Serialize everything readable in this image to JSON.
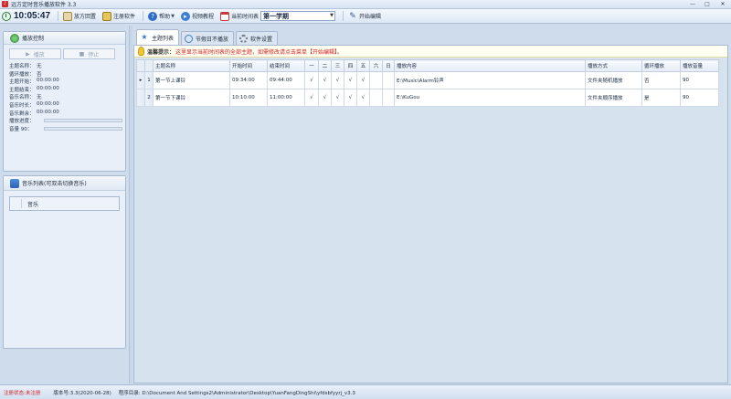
{
  "window": {
    "title": "远方定时音乐播放软件 3.3",
    "min": "—",
    "max": "□",
    "close": "✕"
  },
  "toolbar": {
    "time": "10:05:47",
    "desktop": "放方回置",
    "register": "注册软件",
    "help": "帮助",
    "video_tutorial": "视频教程",
    "current_schedule_label": "当前时间表",
    "current_schedule_value": "第一学期",
    "edit": "开始编辑"
  },
  "play_control": {
    "title": "播放控制",
    "play_label": "播放",
    "stop_label": "停止",
    "info": [
      {
        "label": "主题名称：",
        "value": "无"
      },
      {
        "label": "循环播放：",
        "value": "否"
      },
      {
        "label": "主题开始：",
        "value": "00:00:00"
      },
      {
        "label": "主题结束：",
        "value": "00:00:00"
      },
      {
        "label": "音乐名称：",
        "value": "无"
      },
      {
        "label": "音乐时长：",
        "value": "00:00:00"
      },
      {
        "label": "音乐剩余：",
        "value": "00:00:00"
      }
    ],
    "progress_label": "播放进度：",
    "volume_label": "音量 90：",
    "progress": 0,
    "volume": 90
  },
  "music_list": {
    "title": "音乐列表(可双击切换音乐)",
    "column_header": "音乐"
  },
  "tabs": [
    {
      "label": "主题列表",
      "icon": "star-icon"
    },
    {
      "label": "节假日不播放",
      "icon": "search-icon"
    },
    {
      "label": "软件设置",
      "icon": "gear-icon"
    }
  ],
  "notice": {
    "label": "温馨提示：",
    "text": "这里显示当前时间表的全部主题，如需修改请点击菜单【开始编辑】。"
  },
  "table": {
    "headers": [
      "主题名称",
      "开始时间",
      "结束时间",
      "一",
      "二",
      "三",
      "四",
      "五",
      "六",
      "日",
      "播放内容",
      "播放方式",
      "循环播放",
      "播放音量"
    ],
    "rows": [
      {
        "num": "1",
        "current": "▸",
        "name": "第一节上课铃",
        "start": "09:34:00",
        "end": "09:44:00",
        "days": [
          "√",
          "√",
          "√",
          "√",
          "√",
          "",
          ""
        ],
        "content": "E:\\Music\\Alarm铃声",
        "mode": "文件夹随机播放",
        "loop": "否",
        "volume": "90"
      },
      {
        "num": "2",
        "current": "",
        "name": "第一节下课铃",
        "start": "10:10:00",
        "end": "11:00:00",
        "days": [
          "√",
          "√",
          "√",
          "√",
          "√",
          "",
          ""
        ],
        "content": "E:\\KuGou",
        "mode": "文件夹顺序播放",
        "loop": "是",
        "volume": "90"
      }
    ]
  },
  "status": {
    "reg_status": "注册状态:未注册",
    "version": "版本号:3.3(2020-06-28)",
    "path": "程序目录: D:\\Document And Settings2\\Administrator\\Desktop\\YuanFangDingShi\\yfdsbfyyrj_v3.3"
  },
  "colors": {
    "accent": "#3b79c9",
    "notice_text": "#d22020",
    "status_unregistered": "#d01c1c"
  }
}
